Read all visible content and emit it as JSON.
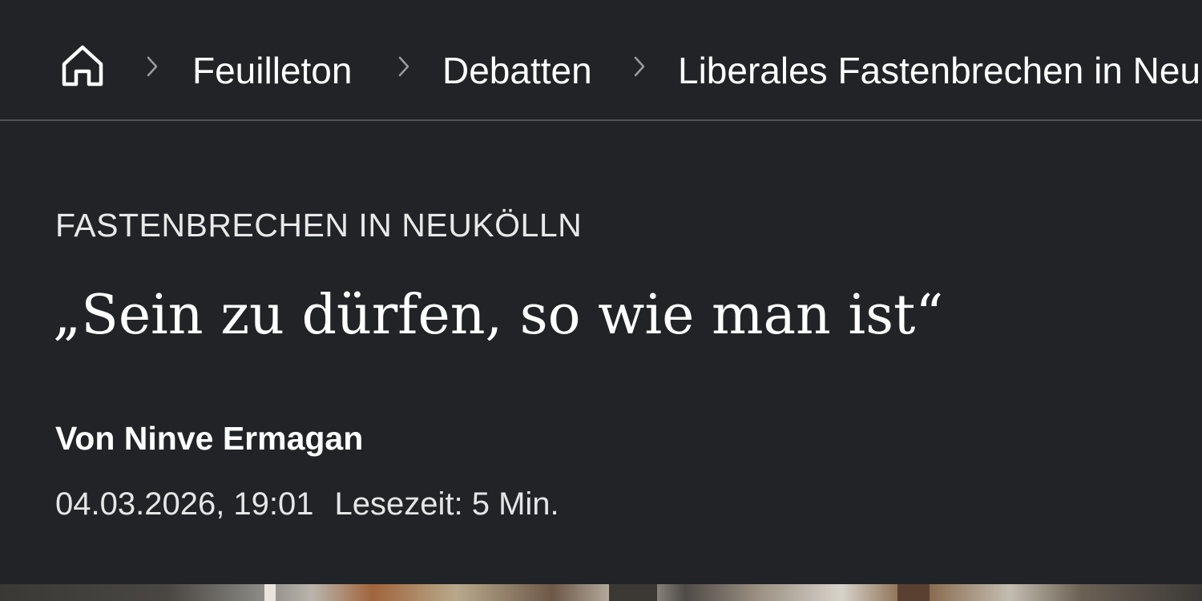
{
  "breadcrumb": {
    "home_icon": "home-icon",
    "separator_icon": "chevron-right-icon",
    "items": [
      {
        "label": "Feuilleton"
      },
      {
        "label": "Debatten"
      },
      {
        "label": "Liberales Fastenbrechen in Neu"
      }
    ]
  },
  "article": {
    "kicker": "FASTENBRECHEN IN NEUKÖLLN",
    "headline": "„Sein zu dürfen, so wie man ist“",
    "author": "Von Ninve Ermagan",
    "date": "04.03.2026, 19:01",
    "reading_time": "Lesezeit: 5 Min."
  },
  "colors": {
    "background": "#212326",
    "divider": "#505357",
    "text": "#ffffff",
    "chevron": "#9a9c9f"
  }
}
